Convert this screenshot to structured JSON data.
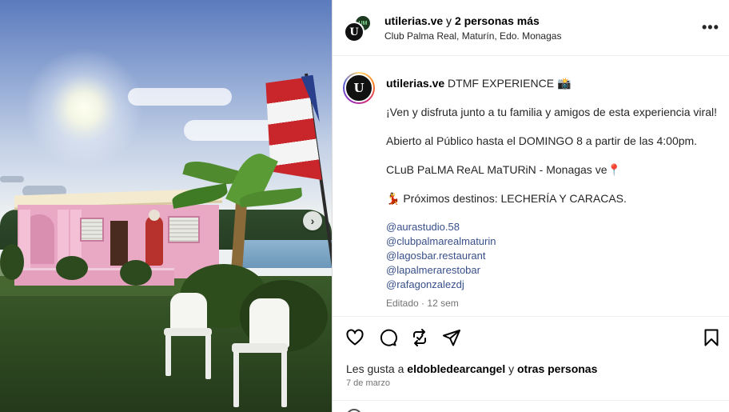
{
  "post_image": {
    "description_icon": "carousel-next-icon",
    "next_button_glyph": "›"
  },
  "header": {
    "account": "utilerias.ve",
    "collab_suffix": "y",
    "collab_count": "2 personas más",
    "location": "Club Palma Real, Maturín, Edo. Monagas",
    "avatar_back_text": "UM",
    "avatar_front_text": "U",
    "more_icon": "more-options-icon",
    "more_glyph": "•••"
  },
  "caption": {
    "author": "utilerias.ve",
    "title": "DTMF EXPERIENCE 📸",
    "line1": "¡Ven y disfruta junto a tu familia y amigos de esta experiencia viral!",
    "line2": "Abierto al Público hasta el DOMINGO 8 a partir de las 4:00pm.",
    "line3": "CLuB PaLMA ReAL MaTURiN - Monagas ve📍",
    "line4": "💃 Próximos destinos: LECHERÍA Y CARACAS.",
    "mentions": [
      "@aurastudio.58",
      "@clubpalmarealmaturin",
      "@lagosbar.restaurant",
      "@lapalmerarestobar",
      "@rafagonzalezdj"
    ],
    "edited": "Editado",
    "separator": "·",
    "age": "12 sem"
  },
  "actions": {
    "like_icon": "heart-icon",
    "comment_icon": "comment-icon",
    "share_icon": "repost-icon",
    "send_icon": "send-icon",
    "save_icon": "bookmark-icon",
    "likes_prefix": "Les gusta a",
    "likes_user": "eldobledearcangel",
    "likes_mid": "y",
    "likes_suffix": "otras personas",
    "date": "7 de marzo"
  },
  "colors": {
    "mention": "#384f8a",
    "muted": "#737373",
    "border": "#dbdbdb"
  }
}
